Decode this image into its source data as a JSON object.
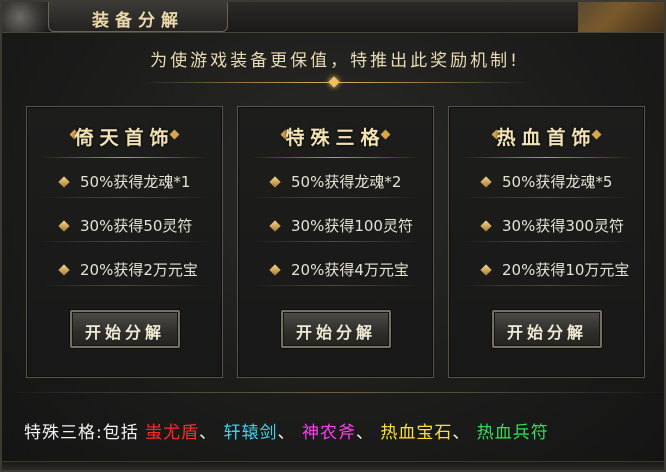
{
  "window": {
    "title": "装备分解",
    "subtitle": "为使游戏装备更保值，特推出此奖励机制!"
  },
  "cards": [
    {
      "title": "倚天首饰",
      "rewards": [
        "50%获得龙魂*1",
        "30%获得50灵符",
        "20%获得2万元宝"
      ],
      "button_label": "开始分解"
    },
    {
      "title": "特殊三格",
      "rewards": [
        "50%获得龙魂*2",
        "30%获得100灵符",
        "20%获得4万元宝"
      ],
      "button_label": "开始分解"
    },
    {
      "title": "热血首饰",
      "rewards": [
        "50%获得龙魂*5",
        "30%获得300灵符",
        "20%获得10万元宝"
      ],
      "button_label": "开始分解"
    }
  ],
  "footer": {
    "prefix": "特殊三格:包括",
    "sep": "、",
    "items": [
      {
        "name": "蚩尤盾",
        "color": "#ff2a2a"
      },
      {
        "name": "轩辕剑",
        "color": "#35d6f0"
      },
      {
        "name": "神农斧",
        "color": "#ff3cf0"
      },
      {
        "name": "热血宝石",
        "color": "#ffe033"
      },
      {
        "name": "热血兵符",
        "color": "#33e05a"
      }
    ],
    "prefix_color": "#f2f2f2"
  },
  "icons": {
    "title_ornament": "diamond-ornament-icon",
    "reward_bullet": "diamond-bullet-icon"
  }
}
